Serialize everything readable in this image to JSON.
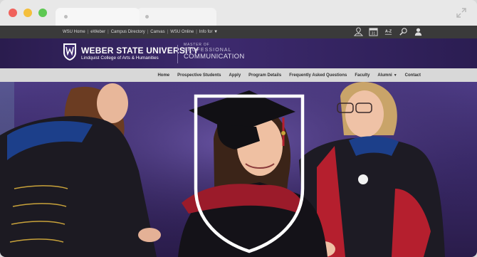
{
  "utility_links": [
    "WSU Home",
    "eWeber",
    "Campus Directory",
    "Canvas",
    "WSU Online",
    "Info for ▼"
  ],
  "toolbar_icons": [
    "map-icon",
    "calendar-icon",
    "a-z-index-icon",
    "search-icon",
    "user-icon"
  ],
  "calendar_day": "31",
  "az_label": "A-Z",
  "header": {
    "university": "WEBER STATE UNIVERSITY",
    "college": "Lindquist College of Arts & Humanities",
    "program_line1": "MASTER OF",
    "program_line2": "PROFESSIONAL",
    "program_line3": "COMMUNICATION"
  },
  "nav": [
    "Home",
    "Prospective Students",
    "Apply",
    "Program Details",
    "Frequently Asked Questions",
    "Faculty",
    "Alumni",
    "Contact"
  ],
  "colors": {
    "purple": "#3d2a6e",
    "topbar": "#3a3a3a",
    "navbar": "#d8d8d8",
    "gown_red": "#b51f2e"
  }
}
